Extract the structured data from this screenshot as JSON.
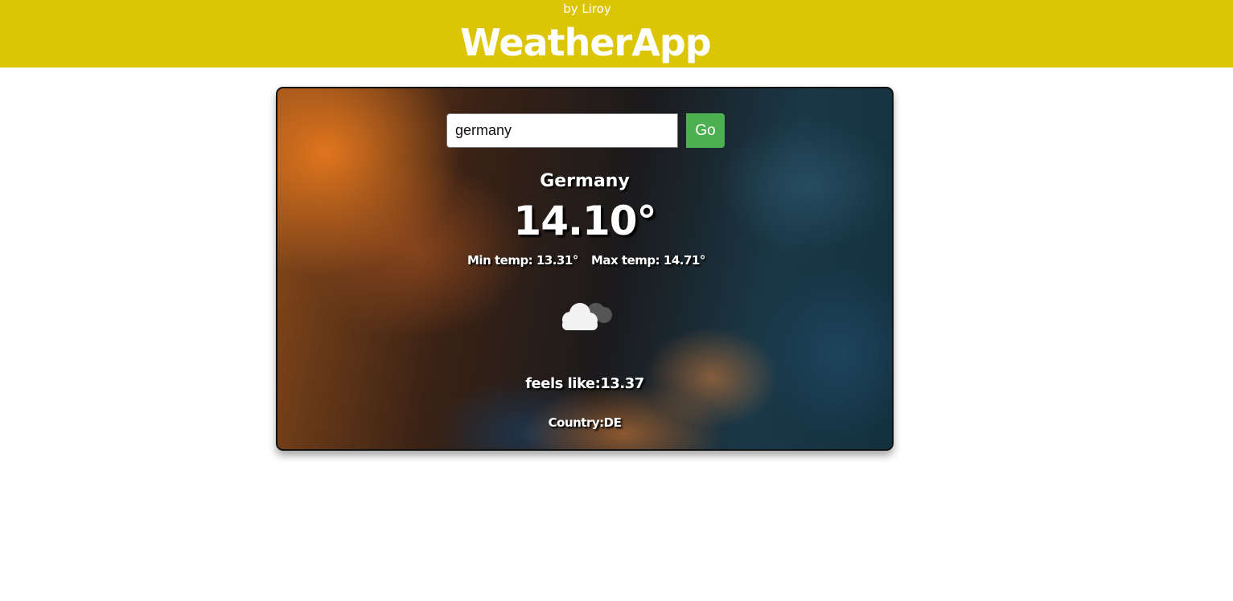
{
  "header": {
    "byline": "by Liroy",
    "title": "WeatherApp",
    "background_color": "#dcc505"
  },
  "search": {
    "value": "germany",
    "placeholder": "",
    "button_label": "Go",
    "button_color": "#4caf50"
  },
  "weather": {
    "city": "Germany",
    "temperature": "14.10°",
    "min_temp": "Min temp: 13.31°",
    "max_temp": "Max temp: 14.71°",
    "icon": "cloud-icon",
    "feels_like": "feels like:13.37",
    "country": "Country:DE"
  }
}
